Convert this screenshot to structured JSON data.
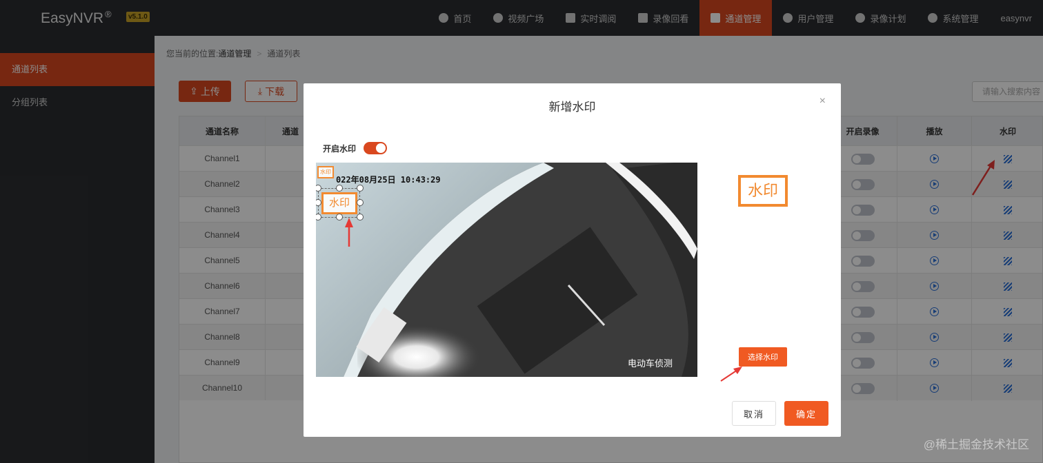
{
  "app": {
    "name": "EasyNVR",
    "reg": "®",
    "version": "v5.1.0"
  },
  "nav": [
    {
      "label": "首页",
      "icon": "dashboard-icon"
    },
    {
      "label": "视频广场",
      "icon": "play-circle-icon"
    },
    {
      "label": "实时调阅",
      "icon": "video-icon"
    },
    {
      "label": "录像回看",
      "icon": "record-icon"
    },
    {
      "label": "通道管理",
      "icon": "channel-icon",
      "active": true
    },
    {
      "label": "用户管理",
      "icon": "user-icon"
    },
    {
      "label": "录像计划",
      "icon": "plan-icon"
    },
    {
      "label": "系统管理",
      "icon": "gear-icon"
    }
  ],
  "user": "easynvr",
  "sidebar": {
    "items": [
      {
        "label": "通道列表",
        "active": true
      },
      {
        "label": "分组列表"
      }
    ]
  },
  "breadcrumb": {
    "prefix": "您当前的位置:",
    "current": "通道管理",
    "sub": "通道列表"
  },
  "toolbar": {
    "upload": "上传",
    "download": "下载",
    "search_placeholder": "请输入搜索内容"
  },
  "table": {
    "headers": {
      "name": "通道名称",
      "code": "通道",
      "record": "开启录像",
      "play": "播放",
      "watermark": "水印"
    },
    "rows": [
      "Channel1",
      "Channel2",
      "Channel3",
      "Channel4",
      "Channel5",
      "Channel6",
      "Channel7",
      "Channel8",
      "Channel9",
      "Channel10"
    ]
  },
  "modal": {
    "title": "新增水印",
    "close": "×",
    "toggle_label": "开启水印",
    "toggle_on": true,
    "timestamp": "022年08月25日 10:43:29",
    "video_caption": "电动车侦测",
    "watermark_small": "水印",
    "watermark_text": "水印",
    "watermark_preview": "水印",
    "select_button": "选择水印",
    "cancel_button": "取消",
    "ok_button": "确定"
  },
  "site_mark": "@稀土掘金技术社区",
  "colors": {
    "accent": "#d9481f",
    "button": "#f05a22",
    "watermark": "#f28a30",
    "link": "#2a6fd8",
    "nav_bg": "#2b2d31"
  }
}
